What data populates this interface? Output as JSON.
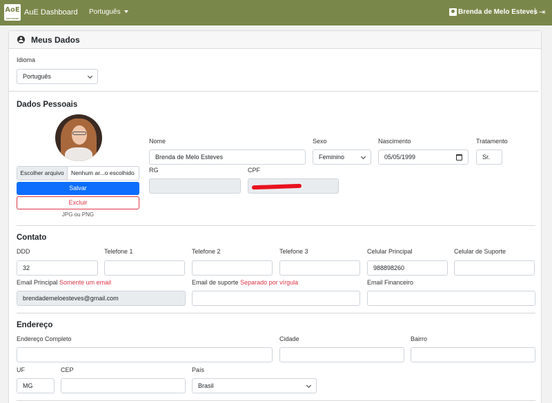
{
  "navbar": {
    "logo_text": "AoE",
    "logo_subtext": "SOFTWARE",
    "brand": "AuE Dashboard",
    "language": "Português",
    "user_name": "Brenda de Melo Esteves",
    "separator": "|",
    "accent_color": "#7a874a"
  },
  "card": {
    "title": "Meus Dados"
  },
  "idioma": {
    "label": "Idioma",
    "value": "Português"
  },
  "personal": {
    "title": "Dados Pessoais",
    "file_button": "Escolher arquivo",
    "file_name": "Nenhum ar...o escolhido",
    "save": "Salvar",
    "delete": "Excluir",
    "file_hint": "JPG ou PNG",
    "nome_label": "Nome",
    "nome_value": "Brenda de Melo Esteves",
    "sexo_label": "Sexo",
    "sexo_value": "Feminino",
    "nascimento_label": "Nascimento",
    "nascimento_value": "05/05/1999",
    "tratamento_label": "Tratamento",
    "tratamento_value": "Sr.",
    "rg_label": "RG",
    "rg_value": "",
    "cpf_label": "CPF"
  },
  "contact": {
    "title": "Contato",
    "ddd_label": "DDD",
    "ddd_value": "32",
    "tel1_label": "Telefone 1",
    "tel2_label": "Telefone 2",
    "tel3_label": "Telefone 3",
    "celular_label": "Celular Principal",
    "celular_value": "988898260",
    "suporte_label": "Celular de Suporte",
    "email_label": "Email Principal",
    "email_hint": "Somente um email",
    "email_value": "brendademeloesteves@gmail.com",
    "email_suporte_label": "Email de suporte",
    "email_suporte_hint": "Separado por vírgula",
    "email_fin_label": "Email Financeiro"
  },
  "address": {
    "title": "Endereço",
    "completo_label": "Endereço Completo",
    "cidade_label": "Cidade",
    "bairro_label": "Bairro",
    "uf_label": "UF",
    "uf_value": "MG",
    "cep_label": "CEP",
    "pais_label": "País",
    "pais_value": "Brasil"
  }
}
